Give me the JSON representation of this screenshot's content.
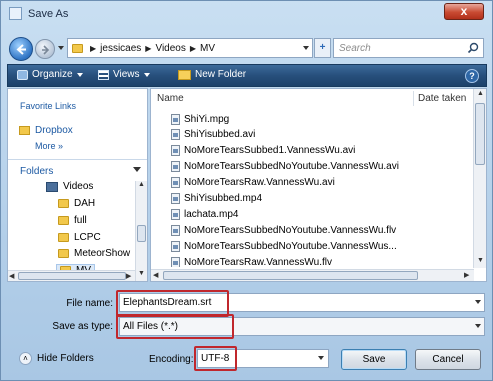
{
  "window": {
    "title": "Save As",
    "close_label": "x"
  },
  "address": {
    "crumbs": [
      "jessicaes",
      "Videos",
      "MV"
    ],
    "refresh_glyph": "+",
    "search_placeholder": "Search"
  },
  "toolbar": {
    "organize": "Organize",
    "views": "Views",
    "new_folder": "New Folder",
    "help": "?"
  },
  "nav": {
    "favorite_links": "Favorite Links",
    "dropbox": "Dropbox",
    "more": "More »",
    "folders": "Folders",
    "tree": [
      {
        "label": "Videos",
        "type": "video"
      },
      {
        "label": "DAH",
        "type": "folder"
      },
      {
        "label": "full",
        "type": "folder"
      },
      {
        "label": "LCPC",
        "type": "folder"
      },
      {
        "label": "MeteorShow",
        "type": "folder"
      },
      {
        "label": "MV",
        "type": "folder"
      }
    ]
  },
  "filelist": {
    "col_name": "Name",
    "col_date": "Date taken",
    "files": [
      "ShiYi.mpg",
      "ShiYisubbed.avi",
      "NoMoreTearsSubbed1.VannessWu.avi",
      "NoMoreTearsSubbedNoYoutube.VannessWu.avi",
      "NoMoreTearsRaw.VannessWu.avi",
      "ShiYisubbed.mp4",
      "lachata.mp4",
      "NoMoreTearsSubbedNoYoutube.VannessWu.flv",
      "NoMoreTearsSubbedNoYoutube.VannessWus...",
      "NoMoreTearsRaw.VannessWu.flv"
    ]
  },
  "form": {
    "filename_label": "File name:",
    "filename_value": "ElephantsDream.srt",
    "savetype_label": "Save as type:",
    "savetype_value": "All Files (*.*)",
    "hide_folders": "Hide Folders",
    "encoding_label": "Encoding:",
    "encoding_value": "UTF-8",
    "save": "Save",
    "cancel": "Cancel"
  },
  "colors": {
    "highlight": "#c0272d",
    "toolbar": "#274f7c",
    "link": "#1d5aa3"
  }
}
